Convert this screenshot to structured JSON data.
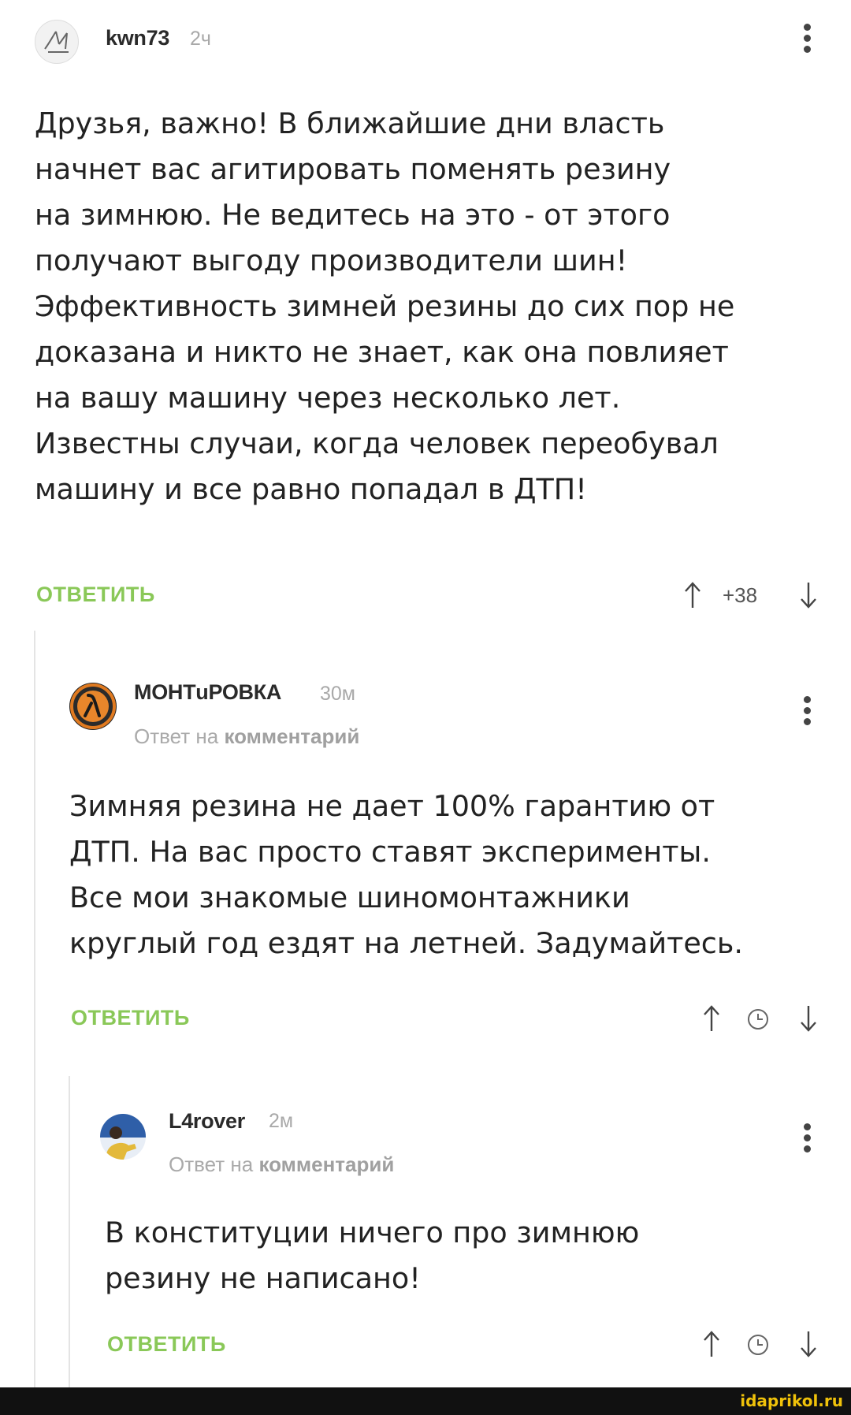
{
  "comments": [
    {
      "author": "kwn73",
      "time": "2ч",
      "lines": [
        "Друзья, важно! В ближайшие дни власть",
        "начнет вас агитировать поменять резину",
        "на зимнюю. Не ведитесь на это - от этого",
        "получают выгоду производители шин!",
        "Эффективность зимней резины до сих пор не",
        "доказана и никто не знает, как она повлияет",
        "на вашу машину через несколько лет.",
        "Известны случаи, когда человек переобувал",
        "машину и все равно попадал в ДТП!"
      ],
      "reply_label": "ОТВЕТИТЬ",
      "rating": "+38"
    },
    {
      "author": "МОНТuРОВКА",
      "time": "30м",
      "reply_to_prefix": "Ответ на",
      "reply_to_link": "комментарий",
      "lines": [
        "Зимняя резина не дает 100% гарантию от",
        "ДТП. На вас просто ставят эксперименты.",
        "Все мои знакомые шиномонтажники",
        "круглый год ездят на летней. Задумайтесь."
      ],
      "reply_label": "ОТВЕТИТЬ"
    },
    {
      "author": "L4rover",
      "time": "2м",
      "reply_to_prefix": "Ответ на",
      "reply_to_link": "комментарий",
      "lines": [
        "В конституции ничего про зимнюю",
        "резину не написано!"
      ],
      "reply_label": "ОТВЕТИТЬ"
    }
  ],
  "watermark": "idaprikol.ru",
  "colors": {
    "reply": "#8ac858",
    "watermark": "#f0c20a"
  }
}
